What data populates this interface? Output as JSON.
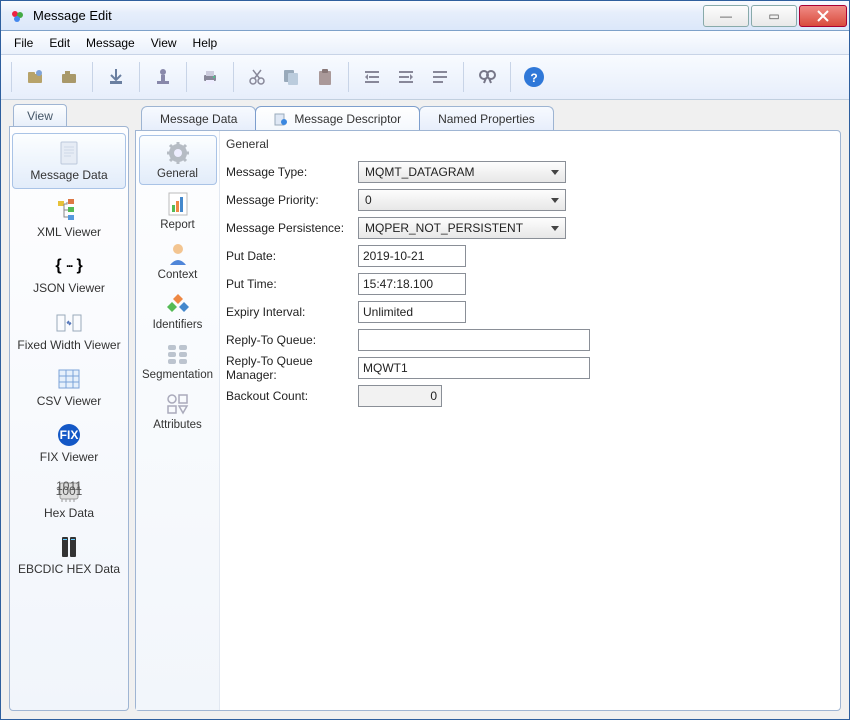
{
  "window": {
    "title": "Message Edit"
  },
  "menu": {
    "items": [
      "File",
      "Edit",
      "Message",
      "View",
      "Help"
    ]
  },
  "left": {
    "tab": "View",
    "items": [
      {
        "label": "Message Data"
      },
      {
        "label": "XML Viewer"
      },
      {
        "label": "JSON Viewer"
      },
      {
        "label": "Fixed Width Viewer"
      },
      {
        "label": "CSV Viewer"
      },
      {
        "label": "FIX Viewer"
      },
      {
        "label": "Hex Data"
      },
      {
        "label": "EBCDIC HEX Data"
      }
    ]
  },
  "tabs": {
    "items": [
      "Message Data",
      "Message Descriptor",
      "Named Properties"
    ],
    "active": 1
  },
  "cats": {
    "items": [
      "General",
      "Report",
      "Context",
      "Identifiers",
      "Segmentation",
      "Attributes"
    ],
    "active": 0
  },
  "form": {
    "group": "General",
    "labels": {
      "type": "Message Type:",
      "priority": "Message Priority:",
      "persistence": "Message Persistence:",
      "putdate": "Put Date:",
      "puttime": "Put Time:",
      "expiry": "Expiry Interval:",
      "rtq": "Reply-To Queue:",
      "rtqm": "Reply-To Queue Manager:",
      "backout": "Backout Count:"
    },
    "values": {
      "type": "MQMT_DATAGRAM",
      "priority": "0",
      "persistence": "MQPER_NOT_PERSISTENT",
      "putdate": "2019-10-21",
      "puttime": "15:47:18.100",
      "expiry": "Unlimited",
      "rtq": "",
      "rtqm": "MQWT1",
      "backout": "0"
    }
  }
}
